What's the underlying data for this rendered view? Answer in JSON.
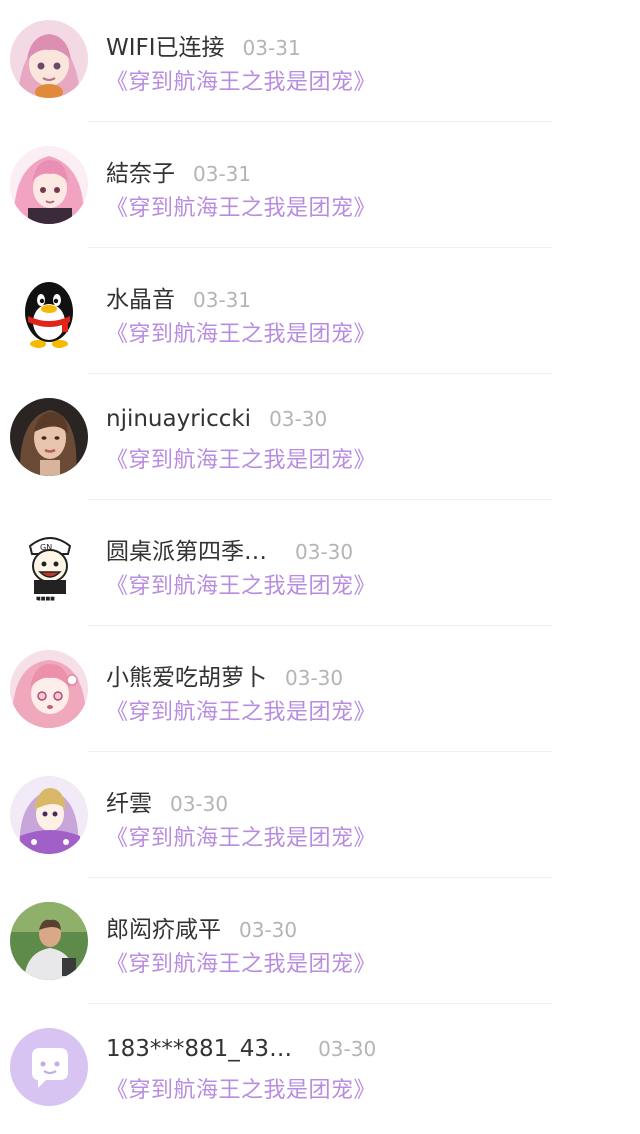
{
  "items": [
    {
      "name": "WIFI已连接",
      "date": "03-31",
      "book": "《穿到航海王之我是团宠》",
      "avatar_icon": "anime-girl-pink-hair-avatar"
    },
    {
      "name": "結奈子",
      "date": "03-31",
      "book": "《穿到航海王之我是团宠》",
      "avatar_icon": "anime-girl-pink-twintails-avatar"
    },
    {
      "name": "水晶音",
      "date": "03-31",
      "book": "《穿到航海王之我是团宠》",
      "avatar_icon": "qq-penguin-avatar"
    },
    {
      "name": "njinuayriccki",
      "date": "03-30",
      "book": "《穿到航海王之我是团宠》",
      "avatar_icon": "woman-portrait-avatar"
    },
    {
      "name": "圆桌派第四季…",
      "date": "03-30",
      "book": "《穿到航海王之我是团宠》",
      "avatar_icon": "cartoon-man-cap-avatar"
    },
    {
      "name": "小熊爱吃胡萝卜",
      "date": "03-30",
      "book": "《穿到航海王之我是团宠》",
      "avatar_icon": "anime-girl-pink-avatar"
    },
    {
      "name": "纤雲",
      "date": "03-30",
      "book": "《穿到航海王之我是团宠》",
      "avatar_icon": "anime-girl-purple-avatar"
    },
    {
      "name": "郎闳疥咸平",
      "date": "03-30",
      "book": "《穿到航海王之我是团宠》",
      "avatar_icon": "man-photo-avatar"
    },
    {
      "name": "183***881_43…",
      "date": "03-30",
      "book": "《穿到航海王之我是团宠》",
      "avatar_icon": "default-chat-bubble-avatar"
    }
  ],
  "colors": {
    "name": "#333333",
    "date": "#b4b4b4",
    "book": "#b88ce0",
    "default_avatar_bg": "#d8c4f2"
  }
}
